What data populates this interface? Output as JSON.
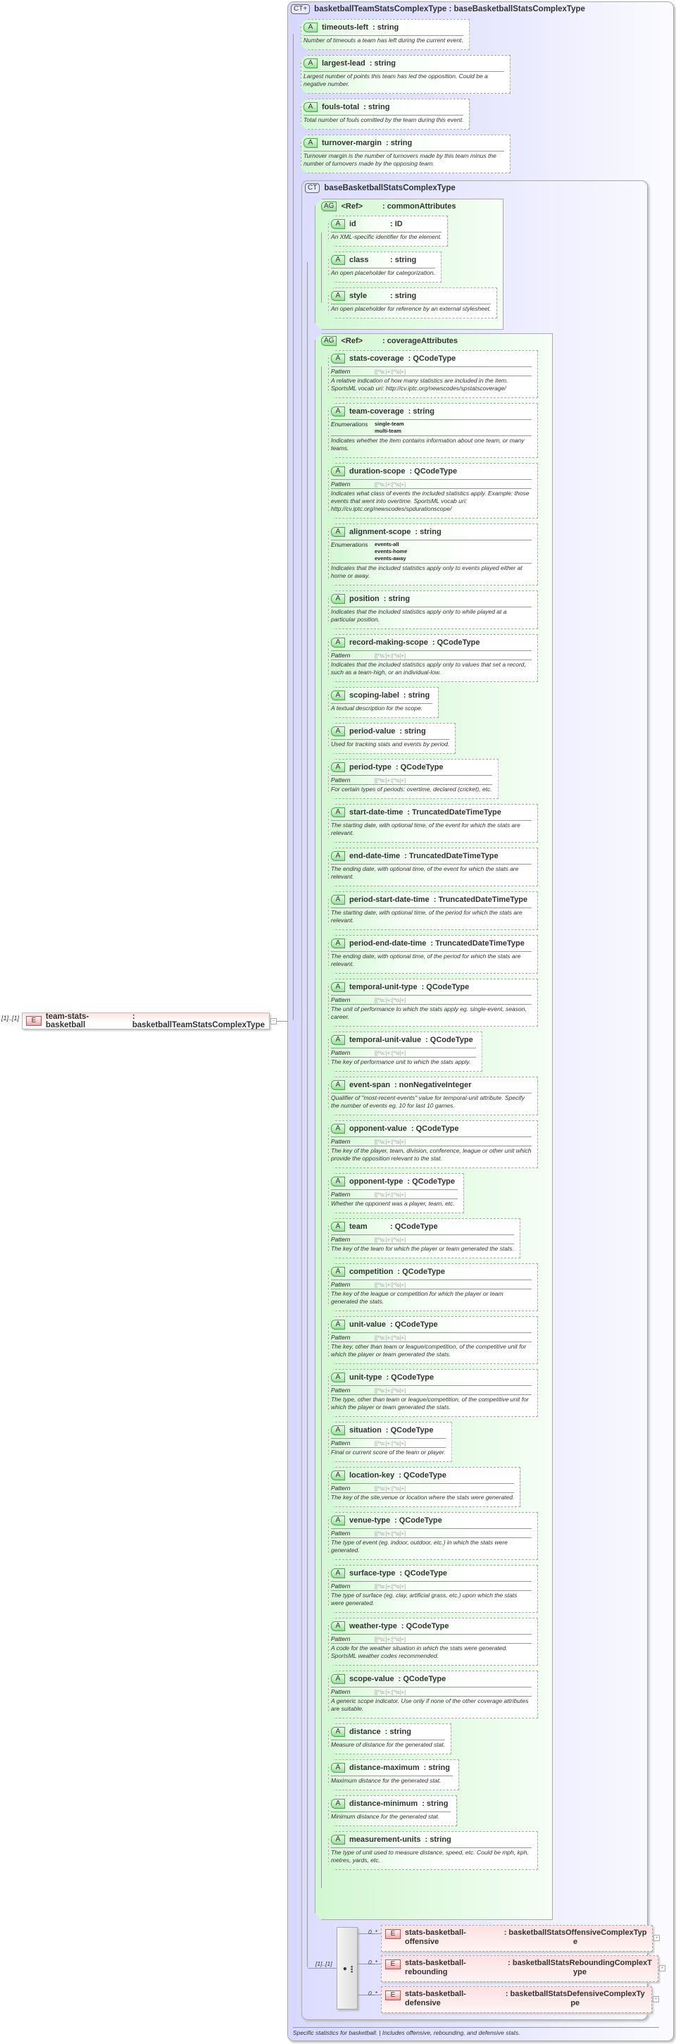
{
  "badges": {
    "attribute": "A",
    "attribute_group": "AG",
    "complex_type": "CT",
    "element": "E",
    "expand": "+",
    "collapse": "−"
  },
  "root_element": {
    "cardinality": "[1]..[1]",
    "name": "team-stats-basketball",
    "type": ": basketballTeamStatsComplexType"
  },
  "outer_type": {
    "title": "basketballTeamStatsComplexType : baseBasketballStatsComplexType",
    "badge": "CT+"
  },
  "direct_attributes": [
    {
      "name": "timeouts-left",
      "type": ": string",
      "desc": "Number of timeouts a team has left during the current event."
    },
    {
      "name": "largest-lead",
      "type": ": string",
      "desc": "Largest number of points this team has led the opposition. Could be a negative number."
    },
    {
      "name": "fouls-total",
      "type": ": string",
      "desc": "Total number of fouls comitted by the team during this event."
    },
    {
      "name": "turnover-margin",
      "type": ": string",
      "desc": "Turnover margin is the number of turnovers made by this team minus the number of turnovers made by the opposing team."
    }
  ],
  "inner_type": {
    "title": "baseBasketballStatsComplexType"
  },
  "common_group": {
    "ref": "<Ref>",
    "type": ": commonAttributes",
    "attributes": [
      {
        "name": "id",
        "type": ": ID",
        "desc": "An XML-specific identifier for the element.",
        "padded": true
      },
      {
        "name": "class",
        "type": ": string",
        "desc": "An open placeholder for categorization.",
        "padded": true
      },
      {
        "name": "style",
        "type": ": string",
        "desc": "An open placeholder for reference by an external stylesheet.",
        "padded": true
      }
    ]
  },
  "coverage_group": {
    "ref": "<Ref>",
    "type": ": coverageAttributes",
    "pattern_label": "Pattern",
    "enum_label": "Enumerations",
    "attributes": [
      {
        "name": "stats-coverage",
        "type": ": QCodeType",
        "pattern": "[[^\\s:]+:[^\\s]+]",
        "desc": "A relative indication of how many statistics are included in the item. SportsML vocab uri: http://cv.iptc.org/newscodes/spstatscoverage/"
      },
      {
        "name": "team-coverage",
        "type": ": string",
        "enums": [
          "single-team",
          "multi-team"
        ],
        "desc": "Indicates whether the item contains information about one team, or many teams."
      },
      {
        "name": "duration-scope",
        "type": ": QCodeType",
        "pattern": "[[^\\s:]+:[^\\s]+]",
        "desc": "Indicates what class of events the included statistics apply. Example: those events that went into overtime. SportsML vocab uri: http://cv.iptc.org/newscodes/spdurationscope/"
      },
      {
        "name": "alignment-scope",
        "type": ": string",
        "enums": [
          "events-all",
          "events-home",
          "events-away"
        ],
        "desc": "Indicates that the included statistics apply only to events played either at home or away."
      },
      {
        "name": "position",
        "type": ": string",
        "desc": "Indicates that the included statistics apply only to while played at a particular position."
      },
      {
        "name": "record-making-scope",
        "type": ": QCodeType",
        "pattern": "[[^\\s:]+:[^\\s]+]",
        "desc": "Indicates that the included statistics apply only to values that set a record, such as a team-high, or an individual-low."
      },
      {
        "name": "scoping-label",
        "type": ": string",
        "desc": "A textual description for the scope."
      },
      {
        "name": "period-value",
        "type": ": string",
        "desc": "Used for tracking stats and events by period."
      },
      {
        "name": "period-type",
        "type": ": QCodeType",
        "pattern": "[[^\\s:]+:[^\\s]+]",
        "desc": "For certain types of periods: overtime, declared (cricket), etc."
      },
      {
        "name": "start-date-time",
        "type": ": TruncatedDateTimeType",
        "desc": "The starting date, with optional time, of the event for which the stats are relevant."
      },
      {
        "name": "end-date-time",
        "type": ": TruncatedDateTimeType",
        "desc": "The ending date, with optional time, of the event for which the stats are relevant."
      },
      {
        "name": "period-start-date-time",
        "type": ": TruncatedDateTimeType",
        "desc": "The starting date, with optional time, of the period for which the stats are relevant."
      },
      {
        "name": "period-end-date-time",
        "type": ": TruncatedDateTimeType",
        "desc": "The ending date, with optional time, of the period for which the stats are relevant."
      },
      {
        "name": "temporal-unit-type",
        "type": ": QCodeType",
        "pattern": "[[^\\s:]+:[^\\s]+]",
        "desc": "The unit of performance to which the stats apply eg. single-event, season, career."
      },
      {
        "name": "temporal-unit-value",
        "type": ": QCodeType",
        "pattern": "[[^\\s:]+:[^\\s]+]",
        "desc": "The key of performance unit to which the stats apply."
      },
      {
        "name": "event-span",
        "type": ": nonNegativeInteger",
        "desc": "Qualifier of \"most-recent-events\" value for temporal-unit attribute. Specify the number of events eg. 10 for last 10 games."
      },
      {
        "name": "opponent-value",
        "type": ": QCodeType",
        "pattern": "[[^\\s:]+:[^\\s]+]",
        "desc": "The key of the player, team, division, conference, league or other unit which provide the opposition relevant to the stat."
      },
      {
        "name": "opponent-type",
        "type": ": QCodeType",
        "pattern": "[[^\\s:]+:[^\\s]+]",
        "desc": "Whether the opponent was a player, team, etc."
      },
      {
        "name": "team",
        "type": ": QCodeType",
        "pattern": "[[^\\s:]+:[^\\s]+]",
        "desc": "The key of the team for which the player or team generated the stats.",
        "padded": true
      },
      {
        "name": "competition",
        "type": ": QCodeType",
        "pattern": "[[^\\s:]+:[^\\s]+]",
        "desc": "The key of the league or competition for which the player or team generated the stats."
      },
      {
        "name": "unit-value",
        "type": ": QCodeType",
        "pattern": "[[^\\s:]+:[^\\s]+]",
        "desc": "The key, other than team or league/competition, of the competitive unit for which the player or team generated the stats."
      },
      {
        "name": "unit-type",
        "type": ": QCodeType",
        "pattern": "[[^\\s:]+:[^\\s]+]",
        "desc": "The type, other than team or league/competition, of the competitive unit for which the player or team generated the stats."
      },
      {
        "name": "situation",
        "type": ": QCodeType",
        "pattern": "[[^\\s:]+:[^\\s]+]",
        "desc": "Final or current score of the team or player."
      },
      {
        "name": "location-key",
        "type": ": QCodeType",
        "pattern": "[[^\\s:]+:[^\\s]+]",
        "desc": "The key of the site,venue or location where the stats were generated."
      },
      {
        "name": "venue-type",
        "type": ": QCodeType",
        "pattern": "[[^\\s:]+:[^\\s]+]",
        "desc": "The type of event (eg. indoor, outdoor, etc.) in which the stats were generated."
      },
      {
        "name": "surface-type",
        "type": ": QCodeType",
        "pattern": "[[^\\s:]+:[^\\s]+]",
        "desc": "The type of surface (eg. clay, artificial grass, etc.) upon which the stats were generated."
      },
      {
        "name": "weather-type",
        "type": ": QCodeType",
        "pattern": "[[^\\s:]+:[^\\s]+]",
        "desc": "A code for the weather situation in which the stats were generated. SportsML weather codes recommended."
      },
      {
        "name": "scope-value",
        "type": ": QCodeType",
        "pattern": "[[^\\s:]+:[^\\s]+]",
        "desc": "A generic scope indicator. Use only if none of the other coverage attributes are suitable."
      },
      {
        "name": "distance",
        "type": ": string",
        "desc": "Measure of distance for the generated stat."
      },
      {
        "name": "distance-maximum",
        "type": ": string",
        "desc": "Maximum distance for the generated stat."
      },
      {
        "name": "distance-minimum",
        "type": ": string",
        "desc": "Minimum distance for the generated stat."
      },
      {
        "name": "measurement-units",
        "type": ": string",
        "desc": "The type of unit used to measure distance, speed, etc. Could be mph, kph, metres, yards, etc."
      }
    ]
  },
  "sequence": {
    "cardinality": "[1]..[1]",
    "children": [
      {
        "cardinality": "0..*",
        "name": "stats-basketball-offensive",
        "type": ": basketballStatsOffensiveComplexType"
      },
      {
        "cardinality": "0..*",
        "name": "stats-basketball-rebounding",
        "type": ": basketballStatsReboundingComplexType"
      },
      {
        "cardinality": "0..*",
        "name": "stats-basketball-defensive",
        "type": ": basketballStatsDefensiveComplexType"
      }
    ]
  },
  "footer": "Specific statistics for basketball. | Includes offensive, rebounding, and defensive stats."
}
